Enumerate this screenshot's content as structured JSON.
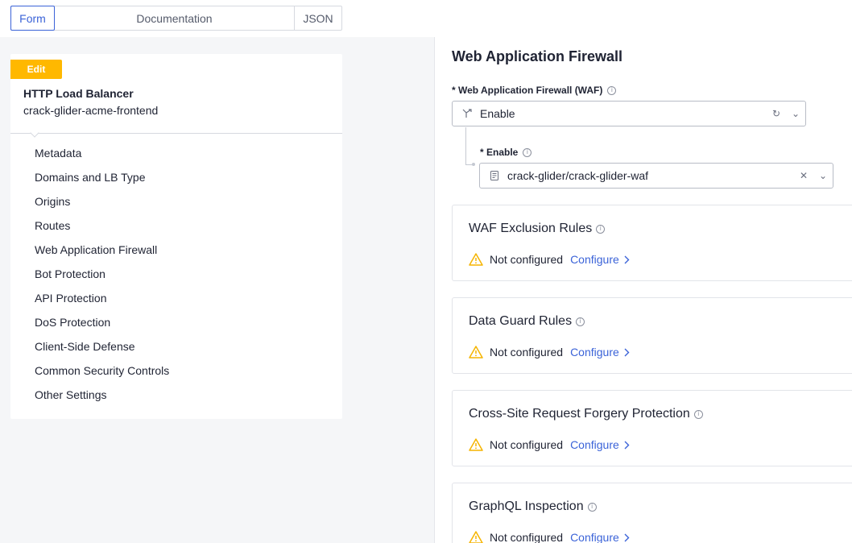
{
  "tabs": {
    "form": "Form",
    "documentation": "Documentation",
    "json": "JSON"
  },
  "card": {
    "badge": "Edit",
    "title": "HTTP Load Balancer",
    "subtitle": "crack-glider-acme-frontend"
  },
  "nav": [
    "Metadata",
    "Domains and LB Type",
    "Origins",
    "Routes",
    "Web Application Firewall",
    "Bot Protection",
    "API Protection",
    "DoS Protection",
    "Client-Side Defense",
    "Common Security Controls",
    "Other Settings"
  ],
  "waf": {
    "section_title": "Web Application Firewall",
    "field_label": "* Web Application Firewall (WAF)",
    "field_value": "Enable",
    "sub_label": "* Enable",
    "sub_value": "crack-glider/crack-glider-waf"
  },
  "panels": [
    {
      "title": "WAF Exclusion Rules",
      "status": "Not configured",
      "link": "Configure"
    },
    {
      "title": "Data Guard Rules",
      "status": "Not configured",
      "link": "Configure"
    },
    {
      "title": "Cross-Site Request Forgery Protection",
      "status": "Not configured",
      "link": "Configure"
    },
    {
      "title": "GraphQL Inspection",
      "status": "Not configured",
      "link": "Configure"
    }
  ],
  "icons": {
    "info": "ⓘ",
    "refresh": "↻",
    "chevron_down": "⌄",
    "clear": "✕",
    "chevron_right": "›"
  },
  "colors": {
    "accent": "#3b63d8",
    "badge": "#ffb800",
    "warning": "#f5b400"
  }
}
